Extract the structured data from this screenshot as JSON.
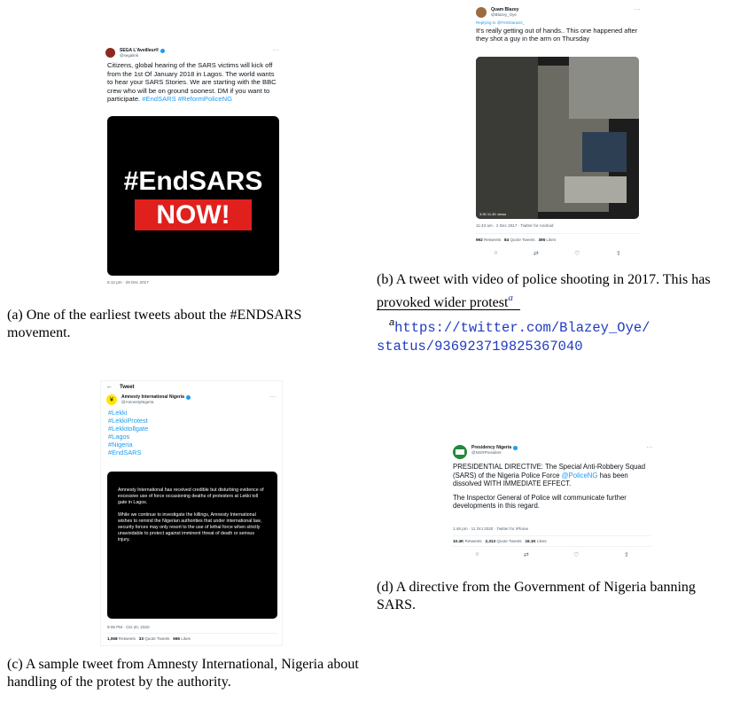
{
  "tweet_a": {
    "name": "SEGA L'Aveilleur®",
    "handle": "@segalink",
    "body": "Citizens, global hearing of the SARS victims will kick off from the 1st Of January 2018 in Lagos. The world wants to hear your SARS Stories. We are starting with the BBC crew who will be on ground soonest. DM if you want to participate.",
    "hashtags": "#EndSARS #ReformPoliceNG",
    "image_line1": "#EndSARS",
    "image_line2": "NOW!",
    "timestamp": "6:12 pm · 29 Dec 2017"
  },
  "caption_a": "(a) One of the earliest tweets about the #ENDSARS movement.",
  "tweet_b": {
    "name": "Quam Blazey",
    "handle": "@Blazey_Oye",
    "replying": "Replying to @FemDaravis_",
    "body": "It's really getting out of hands.. This one happened after they shot a guy in the arm on Thursday",
    "video_overlay": "3:30   11.4K views",
    "meta": "11:43 am · 2 Dec 2017 · Twitter for Android",
    "stat1_num": "992",
    "stat1_label": "Retweets",
    "stat2_num": "84",
    "stat2_label": "Quote Tweets",
    "stat3_num": "395",
    "stat3_label": "Likes"
  },
  "caption_b": "(b) A tweet with video of police shooting in 2017. This has provoked wider protest",
  "footnote_mark": "a",
  "footnote_line1": "https://twitter.com/Blazey_Oye/",
  "footnote_line2": "status/936923719825367040",
  "tweet_c": {
    "header": "Tweet",
    "back_glyph": "←",
    "name": "Amnesty International Nigeria",
    "handle": "@AmnestyNigeria",
    "tags": [
      "#Lekki",
      "#LekkiProtest",
      "#Lekkitollgate",
      "#Lagos",
      "#Nigeria",
      "#EndSARS"
    ],
    "image_para1": "Amnesty International has received credible but disturbing evidence of excessive use of force occasioning deaths of protesters at Lekki toll gate in Lagos.",
    "image_para2": "While we continue to investigate the killings, Amnesty International wishes to remind the Nigerian authorities that under international law, security forces may only resort to the use of lethal force when strictly unavoidable to protect against imminent threat of death or serious injury.",
    "timestamp": "9:08 PM · Oct 20, 2020",
    "stat1_num": "1,068",
    "stat1_label": "Retweets",
    "stat2_num": "33",
    "stat2_label": "Quote Tweets",
    "stat3_num": "666",
    "stat3_label": "Likes"
  },
  "caption_c": "(c) A sample tweet from Amnesty International, Nigeria about handling of the protest by the authority.",
  "tweet_d": {
    "name": "Presidency Nigeria",
    "handle": "@NGRPresident",
    "body1": "PRESIDENTIAL DIRECTIVE: The Special Anti-Robbery Squad (SARS) of the Nigeria Police Force",
    "mention": "@PoliceNG",
    "body1b": "has been dissolved WITH IMMEDIATE EFFECT.",
    "body2": "The Inspector General of Police will communicate further developments in this regard.",
    "meta": "1:48 pm · 11 Oct 2020 · Twitter for iPhone",
    "stat1_num": "10.4K",
    "stat1_label": "Retweets",
    "stat2_num": "2,313",
    "stat2_label": "Quote Tweets",
    "stat3_num": "16.1K",
    "stat3_label": "Likes"
  },
  "caption_d": "(d) A directive from the Government of Nigeria banning SARS.",
  "colors": {
    "link": "#1d9bf0",
    "banner_red": "#e0201c",
    "mono_blue": "#1f3bbf"
  }
}
